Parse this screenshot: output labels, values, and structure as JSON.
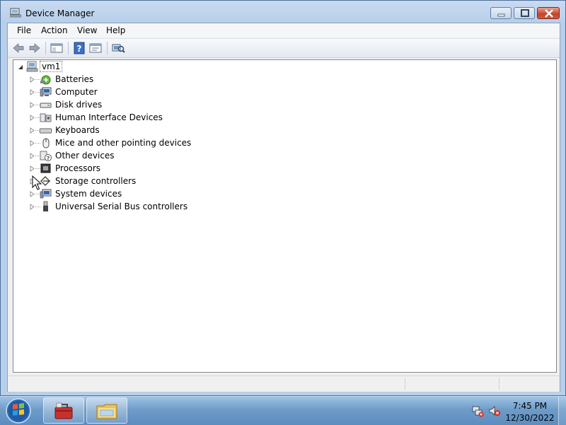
{
  "window": {
    "title": "Device Manager",
    "controls": {
      "minimize": "minimize",
      "maximize": "maximize",
      "close": "close"
    }
  },
  "menu": [
    "File",
    "Action",
    "View",
    "Help"
  ],
  "toolbar_icons": [
    "back-arrow-icon",
    "forward-arrow-icon",
    "console-tree-icon",
    "help-icon",
    "properties-icon",
    "scan-hardware-icon"
  ],
  "tree": {
    "root": "vm1",
    "items": [
      {
        "label": "Batteries",
        "icon": "battery-icon"
      },
      {
        "label": "Computer",
        "icon": "computer-icon"
      },
      {
        "label": "Disk drives",
        "icon": "disk-drive-icon"
      },
      {
        "label": "Human Interface Devices",
        "icon": "hid-icon"
      },
      {
        "label": "Keyboards",
        "icon": "keyboard-icon"
      },
      {
        "label": "Mice and other pointing devices",
        "icon": "mouse-icon"
      },
      {
        "label": "Other devices",
        "icon": "unknown-device-icon"
      },
      {
        "label": "Processors",
        "icon": "processor-icon"
      },
      {
        "label": "Storage controllers",
        "icon": "storage-controller-icon"
      },
      {
        "label": "System devices",
        "icon": "system-device-icon"
      },
      {
        "label": "Universal Serial Bus controllers",
        "icon": "usb-icon"
      }
    ]
  },
  "taskbar": {
    "clock_time": "7:45 PM",
    "clock_date": "12/30/2022",
    "apps": [
      "toolbox-icon",
      "file-explorer-icon"
    ]
  },
  "colors": {
    "accent": "#3a6ea5",
    "close_button": "#c5432a"
  }
}
